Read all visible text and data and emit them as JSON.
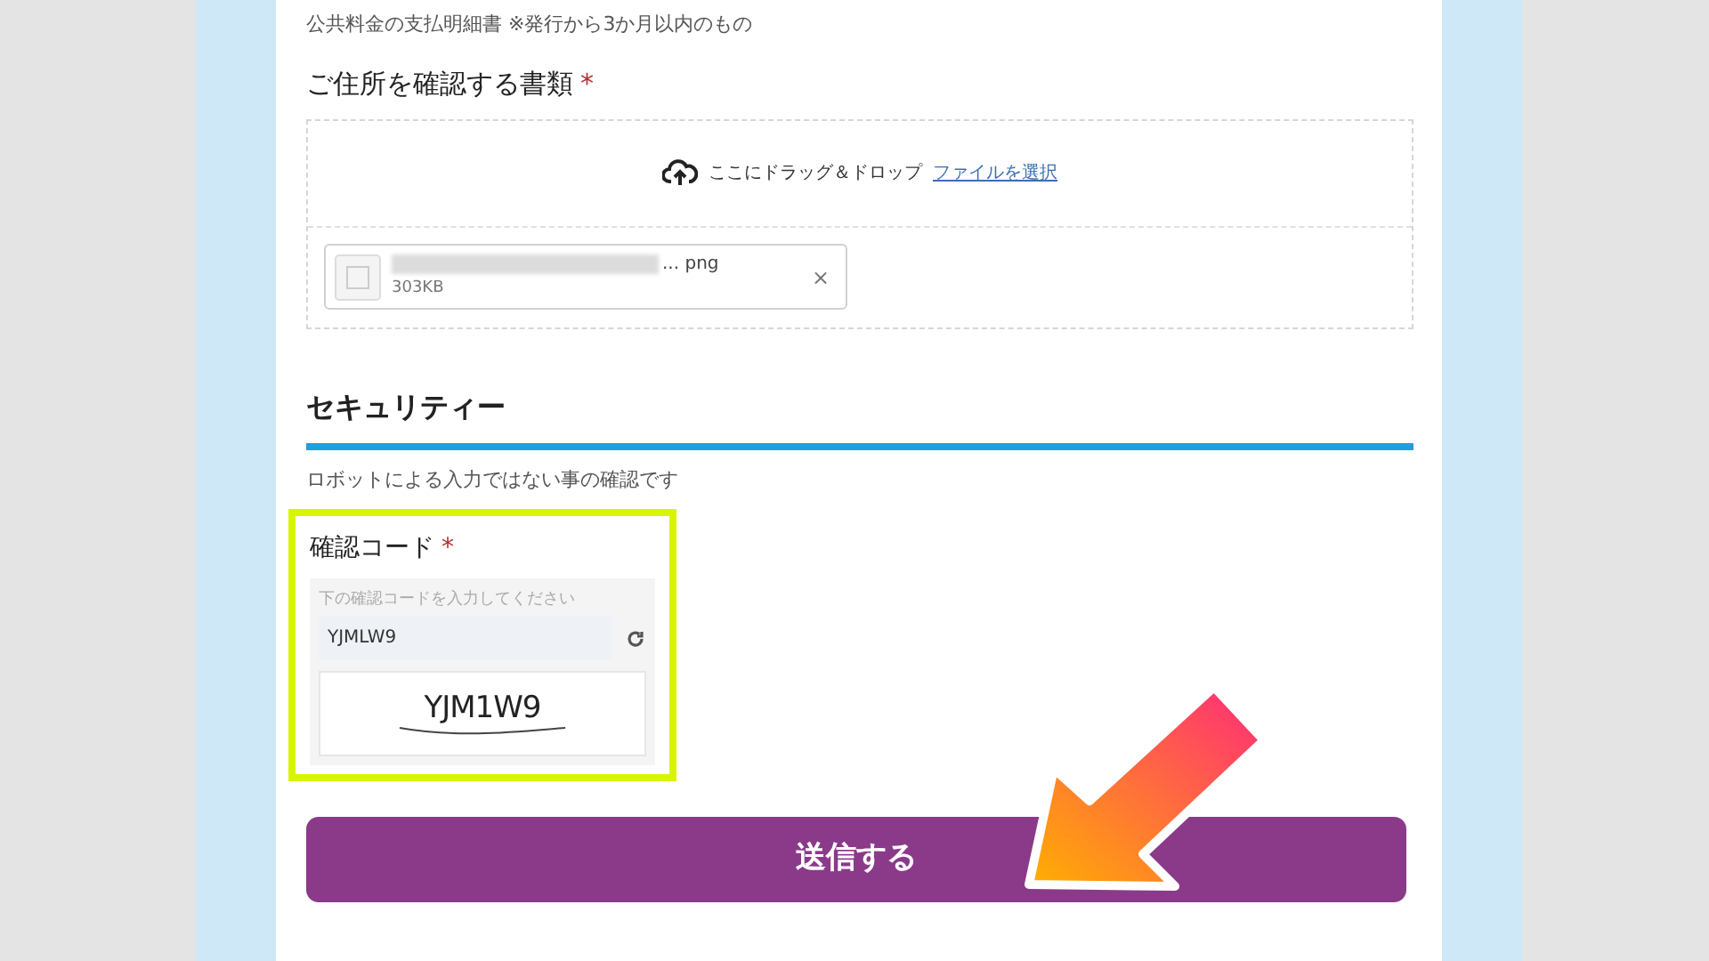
{
  "intro_note": "公共料金の支払明細書 ※発行から3か月以内のもの",
  "address_document": {
    "label": "ご住所を確認する書類",
    "required_mark": "*",
    "drop_text": "ここにドラッグ＆ドロップ",
    "select_link": "ファイルを選択",
    "files": [
      {
        "name": "... png",
        "size": "303KB",
        "remove": "×"
      }
    ]
  },
  "security": {
    "heading": "セキュリティー",
    "description": "ロボットによる入力ではない事の確認です"
  },
  "captcha": {
    "label": "確認コード",
    "required_mark": "*",
    "hint": "下の確認コードを入力してください",
    "value": "YJMLW9",
    "image_text": "YJM1W9",
    "highlighted": true
  },
  "submit_button": "送信する"
}
